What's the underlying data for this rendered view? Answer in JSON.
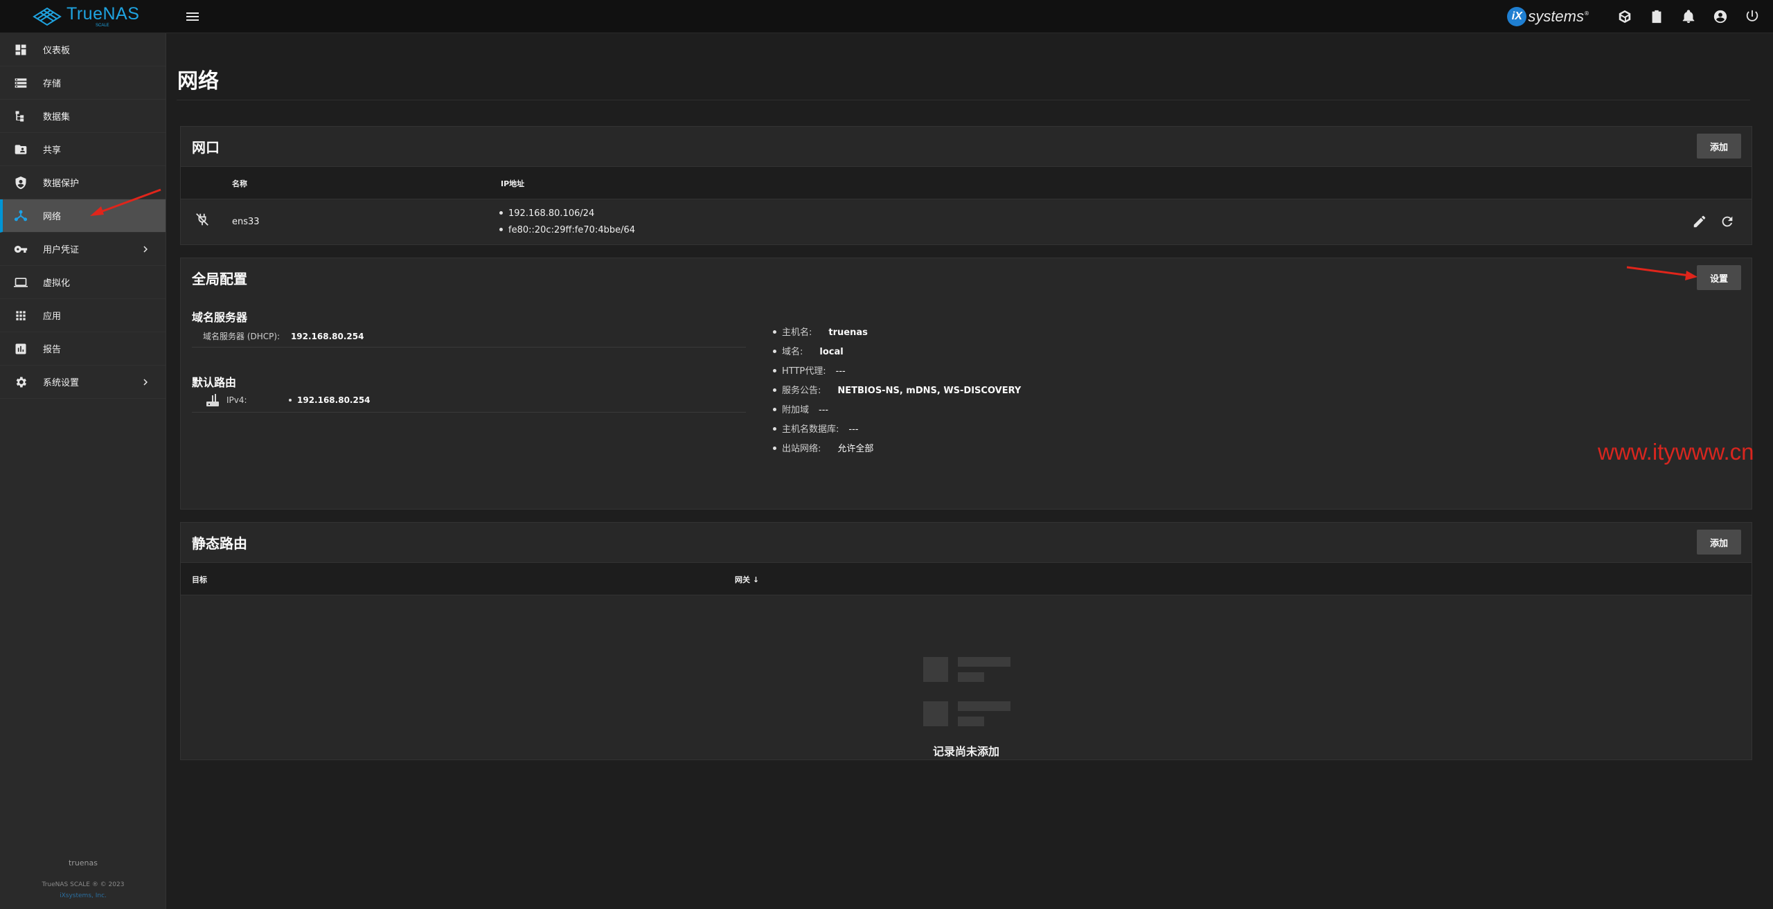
{
  "brand": {
    "name": "TrueNAS",
    "edition": "SCALE"
  },
  "topbar": {
    "partner_logo_ix": "iX",
    "partner_logo_text": "systems",
    "partner_logo_mark": "®"
  },
  "sidebar": {
    "items": [
      {
        "label": "仪表板",
        "icon": "dashboard-icon"
      },
      {
        "label": "存储",
        "icon": "storage-icon"
      },
      {
        "label": "数据集",
        "icon": "datasets-icon"
      },
      {
        "label": "共享",
        "icon": "shares-icon"
      },
      {
        "label": "数据保护",
        "icon": "data-protection-icon"
      },
      {
        "label": "网络",
        "icon": "network-icon",
        "active": true
      },
      {
        "label": "用户凭证",
        "icon": "credentials-icon",
        "expandable": true
      },
      {
        "label": "虚拟化",
        "icon": "virtualization-icon"
      },
      {
        "label": "应用",
        "icon": "apps-icon"
      },
      {
        "label": "报告",
        "icon": "reports-icon"
      },
      {
        "label": "系统设置",
        "icon": "settings-icon",
        "expandable": true
      }
    ],
    "footer": {
      "hostname": "truenas",
      "copyright": "TrueNAS SCALE ® © 2023",
      "company": "iXsystems, Inc."
    }
  },
  "page": {
    "title": "网络"
  },
  "interfaces": {
    "title": "网口",
    "add_label": "添加",
    "columns": [
      "名称",
      "IP地址"
    ],
    "rows": [
      {
        "name": "ens33",
        "ips": [
          "192.168.80.106/24",
          "fe80::20c:29ff:fe70:4bbe/64"
        ]
      }
    ]
  },
  "global_config": {
    "title": "全局配置",
    "settings_label": "设置",
    "dns_title": "域名服务器",
    "dns_label": "域名服务器 (DHCP):",
    "dns_value": "192.168.80.254",
    "route_title": "默认路由",
    "route_label": "IPv4:",
    "route_value": "192.168.80.254",
    "items": [
      {
        "label": "主机名:",
        "value": "truenas"
      },
      {
        "label": "域名:",
        "value": "local"
      },
      {
        "label": "HTTP代理:",
        "value": "---"
      },
      {
        "label": "服务公告:",
        "value": "NETBIOS-NS, mDNS, WS-DISCOVERY"
      },
      {
        "label": "附加域",
        "value": "---"
      },
      {
        "label": "主机名数据库:",
        "value": "---"
      },
      {
        "label": "出站网络:",
        "value": "允许全部"
      }
    ]
  },
  "static_routes": {
    "title": "静态路由",
    "add_label": "添加",
    "columns": [
      "目标",
      "网关"
    ],
    "empty_text": "记录尚未添加"
  },
  "watermark": "www.itywww.cn",
  "colors": {
    "accent": "#0095d5",
    "annotation": "#e0251b"
  }
}
